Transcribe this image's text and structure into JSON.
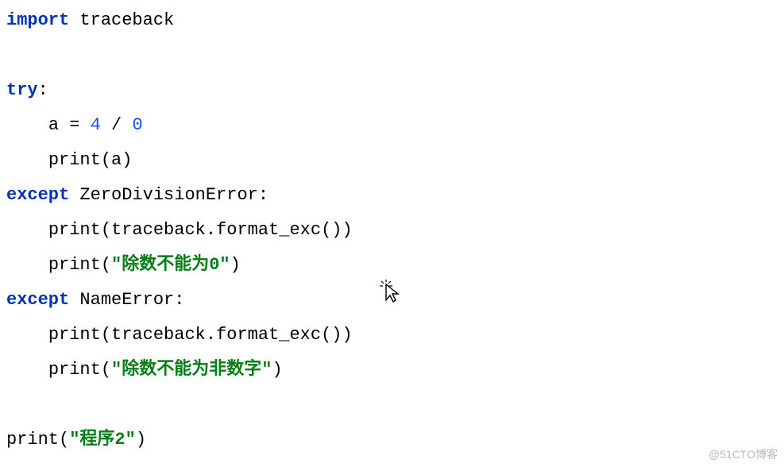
{
  "code": {
    "l1": {
      "kw_import": "import",
      "mod": "traceback"
    },
    "l2": "",
    "l3": {
      "kw_try": "try",
      "colon": ":"
    },
    "l4": {
      "indent": "    ",
      "a": "a",
      "eq": " = ",
      "n1": "4",
      "div": " / ",
      "n2": "0"
    },
    "l5": {
      "indent": "    ",
      "fn": "print",
      "lp": "(",
      "arg": "a",
      "rp": ")"
    },
    "l6": {
      "kw_except": "except",
      "sp": " ",
      "cls": "ZeroDivisionError",
      "colon": ":"
    },
    "l7": {
      "indent": "    ",
      "fn": "print",
      "lp": "(",
      "obj": "traceback",
      "dot": ".",
      "meth": "format_exc",
      "lp2": "(",
      "rp2": ")",
      "rp": ")"
    },
    "l8": {
      "indent": "    ",
      "fn": "print",
      "lp": "(",
      "str": "\"除数不能为0\"",
      "rp": ")"
    },
    "l9": {
      "kw_except": "except",
      "sp": " ",
      "cls": "NameError",
      "colon": ":"
    },
    "l10": {
      "indent": "    ",
      "fn": "print",
      "lp": "(",
      "obj": "traceback",
      "dot": ".",
      "meth": "format_exc",
      "lp2": "(",
      "rp2": ")",
      "rp": ")"
    },
    "l11": {
      "indent": "    ",
      "fn": "print",
      "lp": "(",
      "str": "\"除数不能为非数字\"",
      "rp": ")"
    },
    "l12": "",
    "l13": {
      "fn": "print",
      "lp": "(",
      "str": "\"程序2\"",
      "rp": ")"
    }
  },
  "watermark": "@51CTO博客"
}
